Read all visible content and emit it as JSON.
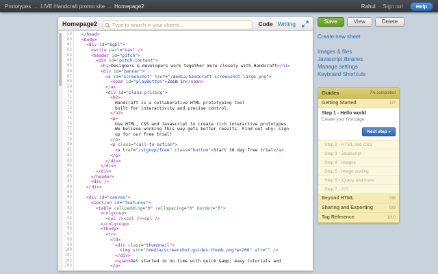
{
  "topbar": {
    "breadcrumb": [
      "Prototypes",
      "LIVE Handcraft promo site",
      "Homepage2"
    ],
    "separator": "→",
    "user": "Rahul",
    "dot": "·",
    "signout": "Sign out",
    "help": "Help"
  },
  "editor": {
    "title": "Homepage2",
    "search_placeholder": "Type to search in your sheets...",
    "mode_code": "Code",
    "mode_writing": "Writing",
    "lines": [
      {
        "n": 59,
        "i": 1,
        "c": "</head>"
      },
      {
        "n": 60,
        "i": 1,
        "c": "<body>"
      },
      {
        "n": 61,
        "i": 2,
        "c": "<div id=\"bgEl\">"
      },
      {
        "n": 62,
        "i": 3,
        "c": "<write part=\"nav\" />"
      },
      {
        "n": 63,
        "i": 3,
        "c": "<header id=\"pitch\">"
      },
      {
        "n": 64,
        "i": 4,
        "c": "<div id=\"pitch-content\">"
      },
      {
        "n": 65,
        "i": 5,
        "c": "<h1>Designers & developers work together more closely with Handcraft</h1>"
      },
      {
        "n": 66,
        "i": 5,
        "c": "<div id=\"banner\">"
      },
      {
        "n": 67,
        "i": 6,
        "c": "<a id=\"screenshot\" href=\"/media/handcraft-screenshot-large.png\">"
      },
      {
        "n": 68,
        "i": 7,
        "c": "<span id=\"playButton\">Zoom in</span>"
      },
      {
        "n": 69,
        "i": 6,
        "c": "</a>"
      },
      {
        "n": 70,
        "i": 6,
        "c": "<div id=\"plans-pricing\">"
      },
      {
        "n": 71,
        "i": 7,
        "c": "<h2>"
      },
      {
        "n": 72,
        "i": 8,
        "c": "Handcraft is a collaborative HTML prototyping tool"
      },
      {
        "n": 73,
        "i": 8,
        "c": "built for interactivity and precise control."
      },
      {
        "n": 74,
        "i": 7,
        "c": "</h2>"
      },
      {
        "n": 75,
        "i": 7,
        "c": "<p>"
      },
      {
        "n": 76,
        "i": 8,
        "c": "Use HTML, CSS and Javascript to create rich interactive prototypes."
      },
      {
        "n": 77,
        "i": 8,
        "c": "We believe working this way gets better results. Find out why: sign"
      },
      {
        "n": 78,
        "i": 8,
        "c": "up for our free trial!"
      },
      {
        "n": 79,
        "i": 7,
        "c": "</p>"
      },
      {
        "n": 80,
        "i": 7,
        "c": "<p class=\"call-to-action\">"
      },
      {
        "n": 81,
        "i": 8,
        "c": "<a href=\"/signup/free\" class=\"button\">Start 30 day free trial</a>"
      },
      {
        "n": 82,
        "i": 7,
        "c": "</p>"
      },
      {
        "n": 83,
        "i": 6,
        "c": "</div>"
      },
      {
        "n": 84,
        "i": 5,
        "c": "</div>"
      },
      {
        "n": 85,
        "i": 4,
        "c": "</div>"
      },
      {
        "n": 86,
        "i": 3,
        "c": "</header>"
      },
      {
        "n": 87,
        "i": 3,
        "c": "<div />"
      },
      {
        "n": 88,
        "i": 2,
        "c": "</div>"
      },
      {
        "n": 89,
        "i": 0,
        "c": ""
      },
      {
        "n": 90,
        "i": 2,
        "c": "<div id=\"canvas\">"
      },
      {
        "n": 91,
        "i": 3,
        "c": "<section id=\"features\">"
      },
      {
        "n": 92,
        "i": 4,
        "c": "<table cellpadding=\"0\" cellspacing=\"0\" border=\"0\">"
      },
      {
        "n": 93,
        "i": 5,
        "c": "<colgroup>"
      },
      {
        "n": 94,
        "i": 6,
        "c": "<col /><col /><col />"
      },
      {
        "n": 95,
        "i": 5,
        "c": "</colgroup>"
      },
      {
        "n": 96,
        "i": 5,
        "c": "<tbody>"
      },
      {
        "n": 97,
        "i": 6,
        "c": "<tr>"
      },
      {
        "n": 98,
        "i": 7,
        "c": "<td>"
      },
      {
        "n": 99,
        "i": 8,
        "c": "<div class=\"thumbnail\">"
      },
      {
        "n": 100,
        "i": 9,
        "c": "<img src=\"/media/screenshot-guides-thumb.png?w=200\" alt=\"\" />"
      },
      {
        "n": 101,
        "i": 8,
        "c": "</div>"
      },
      {
        "n": 102,
        "i": 8,
        "c": "<span>Get started in no time with quick &amp; easy tutorials and"
      },
      {
        "n": 103,
        "i": 7,
        "c": "</p>"
      }
    ]
  },
  "sidebar": {
    "buttons": {
      "save": "Save",
      "view": "View",
      "delete": "Delete"
    },
    "create_link": "Create new sheet",
    "links": [
      "Images & files",
      "Javascript libraries",
      "Manage settings",
      "Keyboard Shortcuts"
    ],
    "guides": {
      "title": "Guides",
      "progress": "7% completed",
      "items": [
        {
          "type": "section",
          "label": "Getting Started",
          "count": "1/7"
        },
        {
          "type": "active",
          "label": "Step 1 - Hello world",
          "desc": "Create your first page.",
          "button": "Next step »"
        },
        {
          "type": "step",
          "label": "Step 2 - HTML and CSS"
        },
        {
          "type": "step",
          "label": "Step 3 - Javascript"
        },
        {
          "type": "step",
          "label": "Step 4 - Images"
        },
        {
          "type": "step",
          "label": "Step 5 - Image scaling"
        },
        {
          "type": "step",
          "label": "Step 6 - jQuery and more"
        },
        {
          "type": "step",
          "label": "Step 7 - ???"
        },
        {
          "type": "section",
          "label": "Beyond HTML",
          "count": "0/8"
        },
        {
          "type": "section",
          "label": "Sharing and Exporting",
          "count": "0/3"
        },
        {
          "type": "section",
          "label": "Tag Reference",
          "count": "1/10"
        }
      ]
    }
  },
  "colors": {
    "accent_blue": "#2b6cb8",
    "save_green": "#5e9a22",
    "syntax_tag": "#8b1fa8",
    "syntax_attribute": "#2e7d32",
    "syntax_string": "#1f3fbf"
  }
}
